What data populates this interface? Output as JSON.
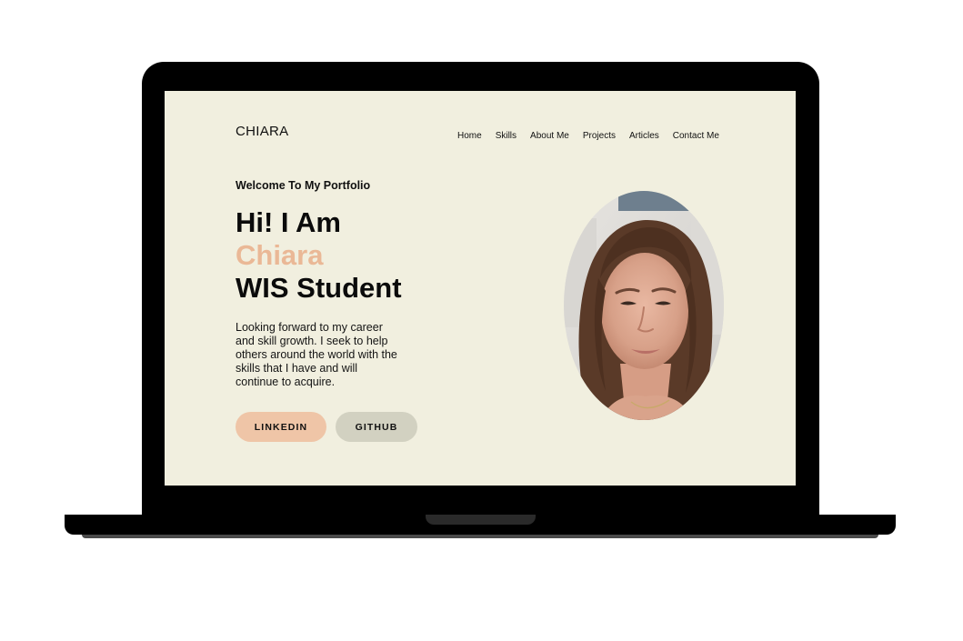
{
  "site": {
    "brand": "CHIARA",
    "nav": [
      "Home",
      "Skills",
      "About Me",
      "Projects",
      "Articles",
      "Contact Me"
    ]
  },
  "hero": {
    "welcome": "Welcome To My Portfolio",
    "headline_line1": "Hi! I Am",
    "headline_name": "Chiara",
    "headline_line3": "WIS Student",
    "bio": "Looking forward to my career and skill growth. I seek to help others around the world with the skills that I have and will continue to acquire.",
    "buttons": {
      "linkedin": "LINKEDIN",
      "github": "GITHUB"
    }
  },
  "colors": {
    "page_background": "#f1efdf",
    "accent": "#eab896",
    "linkedin_button": "#efc5a7",
    "github_button": "#d2d1c1",
    "laptop_frame": "#000000"
  },
  "icons": {
    "portrait": "profile-photo"
  }
}
